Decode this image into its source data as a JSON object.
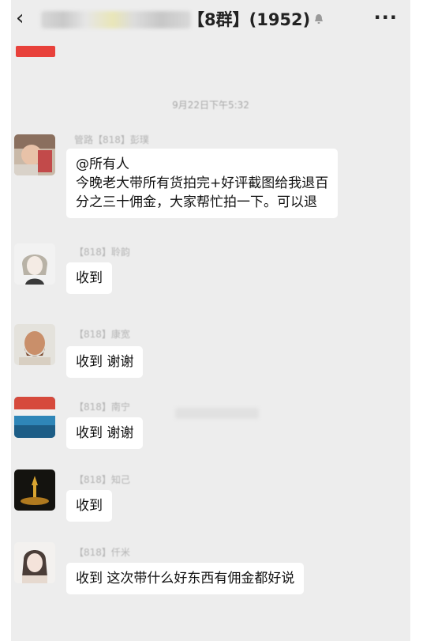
{
  "header": {
    "back_icon": "chevron-left-icon",
    "group_title": "【8群】(1952)",
    "mute_icon": "bell-mute-icon",
    "more_icon": "ellipsis-icon"
  },
  "timestamp": "9月22日下午5:32",
  "messages": [
    {
      "sender": "管路【818】彭璞",
      "lines": [
        "@所有人",
        "今晚老大带所有货拍完+好评截图给我退百",
        "分之三十佣金，大家帮忙拍一下。可以退"
      ]
    },
    {
      "sender": "【818】聆韵",
      "lines": [
        "收到"
      ]
    },
    {
      "sender": "【818】康宽",
      "lines": [
        "收到 谢谢"
      ]
    },
    {
      "sender": "【818】南宁",
      "lines": [
        "收到 谢谢"
      ]
    },
    {
      "sender": "【818】知己",
      "lines": [
        "收到"
      ]
    },
    {
      "sender": "【818】仟米",
      "lines": [
        "收到  这次带什么好东西有佣金都好说"
      ]
    }
  ]
}
